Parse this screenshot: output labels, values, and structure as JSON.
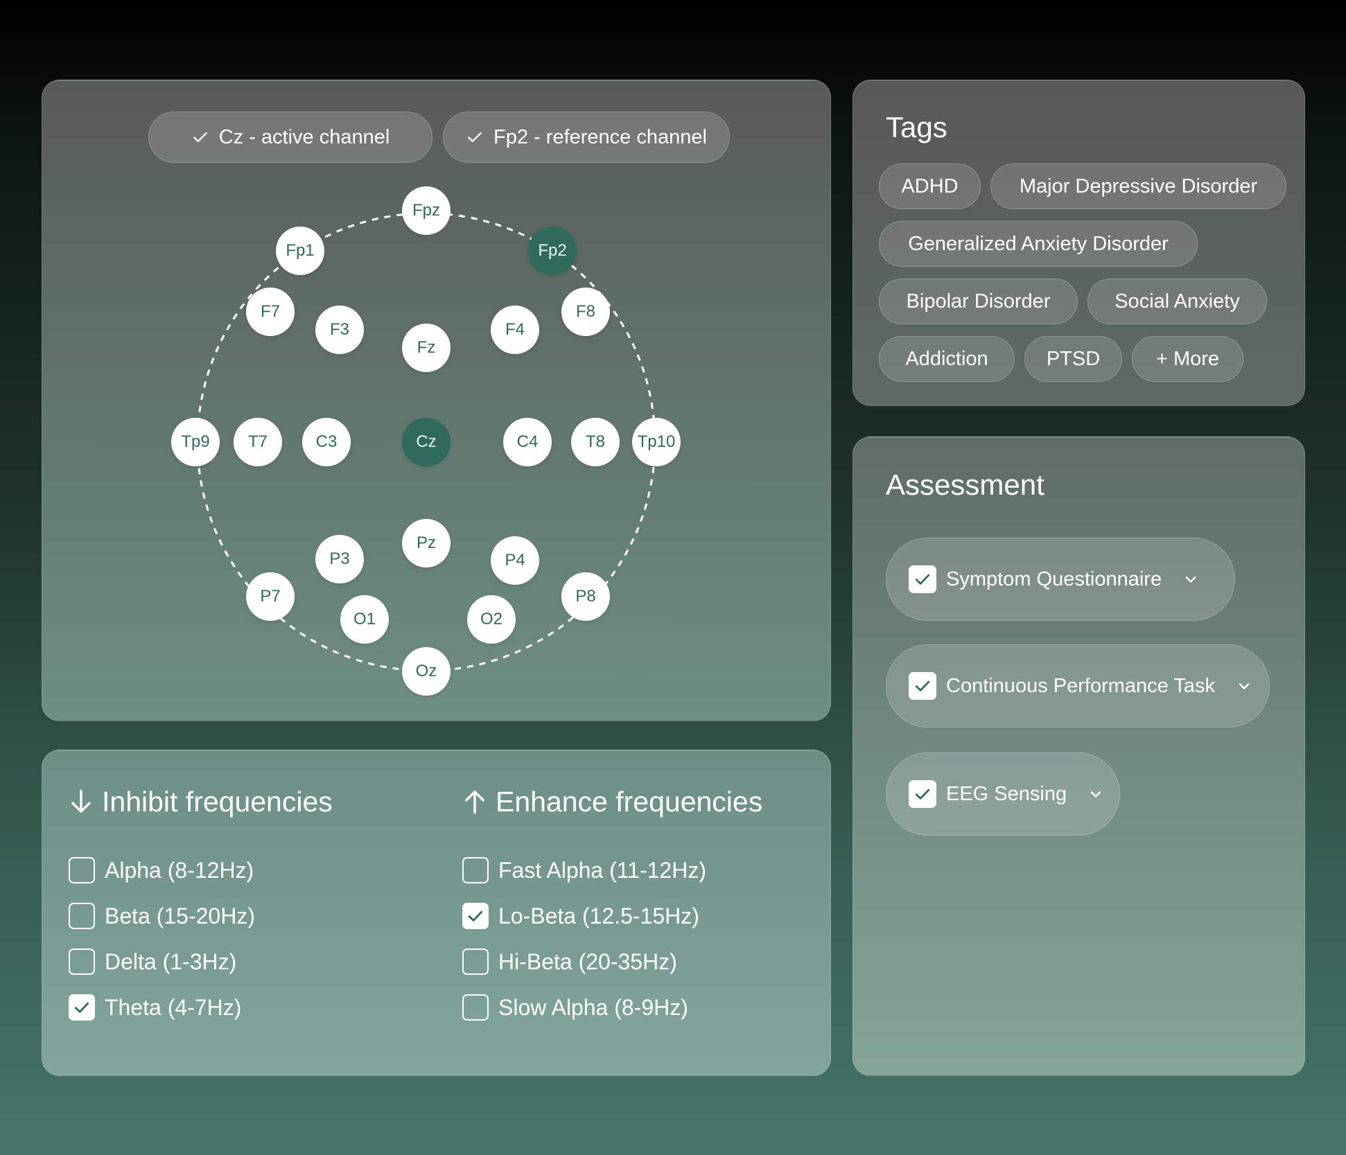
{
  "channels": {
    "active_label": "Cz - active channel",
    "reference_label": "Fp2 - reference channel"
  },
  "electrodes": [
    {
      "label": "Fpz",
      "active": false
    },
    {
      "label": "Fp1",
      "active": false
    },
    {
      "label": "Fp2",
      "active": true
    },
    {
      "label": "F7",
      "active": false
    },
    {
      "label": "F3",
      "active": false
    },
    {
      "label": "Fz",
      "active": false
    },
    {
      "label": "F4",
      "active": false
    },
    {
      "label": "F8",
      "active": false
    },
    {
      "label": "Tp9",
      "active": false
    },
    {
      "label": "T7",
      "active": false
    },
    {
      "label": "C3",
      "active": false
    },
    {
      "label": "Cz",
      "active": true
    },
    {
      "label": "C4",
      "active": false
    },
    {
      "label": "T8",
      "active": false
    },
    {
      "label": "Tp10",
      "active": false
    },
    {
      "label": "P3",
      "active": false
    },
    {
      "label": "Pz",
      "active": false
    },
    {
      "label": "P4",
      "active": false
    },
    {
      "label": "P7",
      "active": false
    },
    {
      "label": "P8",
      "active": false
    },
    {
      "label": "O1",
      "active": false
    },
    {
      "label": "O2",
      "active": false
    },
    {
      "label": "Oz",
      "active": false
    }
  ],
  "inhibit": {
    "title": "Inhibit frequencies",
    "icon": "arrow-down-icon",
    "items": [
      {
        "label": "Alpha (8-12Hz)",
        "checked": false
      },
      {
        "label": "Beta (15-20Hz)",
        "checked": false
      },
      {
        "label": "Delta (1-3Hz)",
        "checked": false
      },
      {
        "label": "Theta (4-7Hz)",
        "checked": true
      }
    ]
  },
  "enhance": {
    "title": "Enhance frequencies",
    "icon": "arrow-up-icon",
    "items": [
      {
        "label": "Fast Alpha (11-12Hz)",
        "checked": false
      },
      {
        "label": "Lo-Beta (12.5-15Hz)",
        "checked": true
      },
      {
        "label": "Hi-Beta (20-35Hz)",
        "checked": false
      },
      {
        "label": "Slow Alpha (8-9Hz)",
        "checked": false
      }
    ]
  },
  "tags": {
    "title": "Tags",
    "items": [
      "ADHD",
      "Major Depressive Disorder",
      "Generalized Anxiety Disorder",
      "Bipolar Disorder",
      "Social Anxiety",
      "Addiction",
      "PTSD"
    ],
    "more_label": "+ More"
  },
  "assessment": {
    "title": "Assessment",
    "items": [
      {
        "label": "Symptom Questionnaire",
        "checked": true
      },
      {
        "label": "Continuous Performance Task",
        "checked": true
      },
      {
        "label": "EEG Sensing",
        "checked": true
      }
    ]
  },
  "colors": {
    "accent": "#2e6b5c",
    "electrode_fill": "#ffffff",
    "electrode_text": "#2e6b5c"
  }
}
